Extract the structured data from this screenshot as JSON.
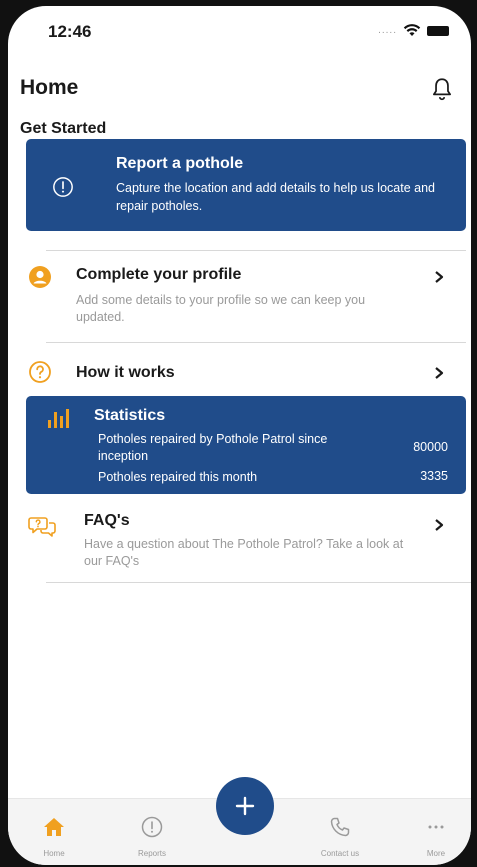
{
  "status_bar": {
    "time": "12:46",
    "signal": "....."
  },
  "header": {
    "title": "Home",
    "notification_icon": "bell-icon"
  },
  "section": {
    "title": "Get Started"
  },
  "report_card": {
    "title": "Report a pothole",
    "description": "Capture the location and add details to help us locate and repair potholes.",
    "icon": "info-icon"
  },
  "list": [
    {
      "title": "Complete your profile",
      "description": "Add some details to your profile so we can keep you updated.",
      "icon": "user-icon"
    },
    {
      "title": "How it works",
      "description": "",
      "icon": "question-icon"
    },
    {
      "title": "FAQ's",
      "description": "Have a question about The Pothole Patrol? Take a look at our FAQ's",
      "icon": "chat-question-icon"
    }
  ],
  "stats": {
    "title": "Statistics",
    "icon": "bar-chart-icon",
    "rows": [
      {
        "label": "Potholes repaired by Pothole Patrol since inception",
        "value": "80000"
      },
      {
        "label": "Potholes repaired this month",
        "value": "3335"
      }
    ]
  },
  "tabs": [
    {
      "label": "Home",
      "icon": "home-icon"
    },
    {
      "label": "Reports",
      "icon": "info-icon"
    },
    {
      "label": "Contact us",
      "icon": "phone-icon"
    },
    {
      "label": "More",
      "icon": "ellipsis-icon"
    }
  ],
  "fab": {
    "icon": "plus-icon"
  },
  "colors": {
    "primary": "#204c8a",
    "accent": "#f0a020",
    "muted": "#9a9a9a"
  }
}
